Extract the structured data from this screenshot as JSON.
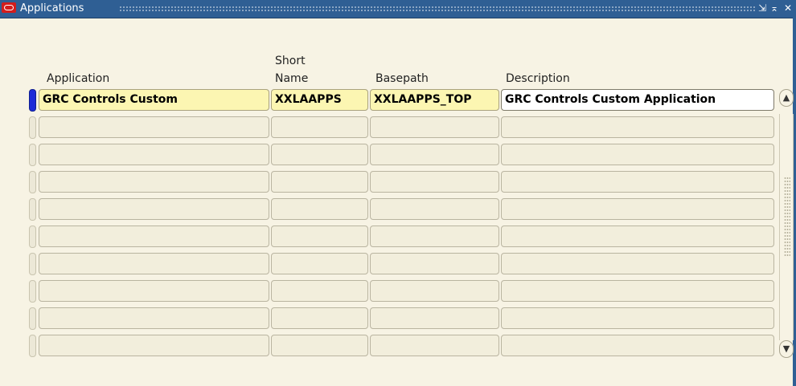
{
  "window": {
    "title": "Applications",
    "controls": [
      "minimize-icon",
      "maximize-icon",
      "close-icon"
    ]
  },
  "columns": {
    "application": "Application",
    "short_name_line1": "Short",
    "short_name_line2": "Name",
    "basepath": "Basepath",
    "description": "Description"
  },
  "rows": [
    {
      "application": "GRC Controls Custom",
      "short_name": "XXLAAPPS",
      "basepath": "XXLAAPPS_TOP",
      "description": "GRC Controls Custom Application"
    },
    {
      "application": "",
      "short_name": "",
      "basepath": "",
      "description": ""
    },
    {
      "application": "",
      "short_name": "",
      "basepath": "",
      "description": ""
    },
    {
      "application": "",
      "short_name": "",
      "basepath": "",
      "description": ""
    },
    {
      "application": "",
      "short_name": "",
      "basepath": "",
      "description": ""
    },
    {
      "application": "",
      "short_name": "",
      "basepath": "",
      "description": ""
    },
    {
      "application": "",
      "short_name": "",
      "basepath": "",
      "description": ""
    },
    {
      "application": "",
      "short_name": "",
      "basepath": "",
      "description": ""
    },
    {
      "application": "",
      "short_name": "",
      "basepath": "",
      "description": ""
    },
    {
      "application": "",
      "short_name": "",
      "basepath": "",
      "description": ""
    }
  ],
  "colors": {
    "titlebar": "#2f5f94",
    "background": "#f7f3e4",
    "required_field": "#fcf6b2",
    "current_record": "#1d2bd8"
  }
}
